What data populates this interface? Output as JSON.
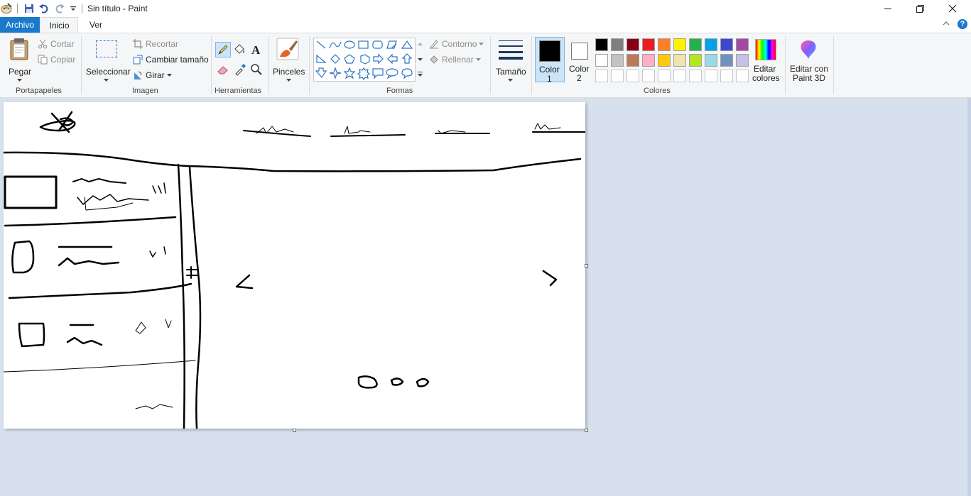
{
  "window": {
    "title": "Sin título - Paint"
  },
  "tabs": {
    "archivo": "Archivo",
    "inicio": "Inicio",
    "ver": "Ver"
  },
  "ribbon": {
    "portapapeles": {
      "group_label": "Portapapeles",
      "paste": "Pegar",
      "cut": "Cortar",
      "copy": "Copiar"
    },
    "imagen": {
      "group_label": "Imagen",
      "select": "Seleccionar",
      "crop": "Recortar",
      "resize": "Cambiar tamaño",
      "rotate": "Girar"
    },
    "herramientas": {
      "group_label": "Herramientas"
    },
    "pinceles": {
      "label": "Pinceles"
    },
    "formas": {
      "group_label": "Formas",
      "outline": "Contorno",
      "fill": "Rellenar"
    },
    "tamano": {
      "label": "Tamaño"
    },
    "colores": {
      "group_label": "Colores",
      "color1_line1": "Color",
      "color1_line2": "1",
      "color2_line1": "Color",
      "color2_line2": "2",
      "edit_colors_line1": "Editar",
      "edit_colors_line2": "colores",
      "color1": "#000000",
      "color2": "#ffffff",
      "palette_row1": [
        "#000000",
        "#7f7f7f",
        "#880015",
        "#ed1c24",
        "#ff7f27",
        "#fff200",
        "#22b14c",
        "#00a2e8",
        "#3f48cc",
        "#a349a4"
      ],
      "palette_row2": [
        "#ffffff",
        "#c3c3c3",
        "#b97a57",
        "#ffaec9",
        "#ffc90e",
        "#efe4b0",
        "#b5e61d",
        "#99d9ea",
        "#7092be",
        "#c8bfe7"
      ],
      "palette_row3": [
        "#ffffff",
        "#ffffff",
        "#ffffff",
        "#ffffff",
        "#ffffff",
        "#ffffff",
        "#ffffff",
        "#ffffff",
        "#ffffff",
        "#ffffff"
      ]
    },
    "paint3d": {
      "line1": "Editar con",
      "line2": "Paint 3D"
    }
  }
}
